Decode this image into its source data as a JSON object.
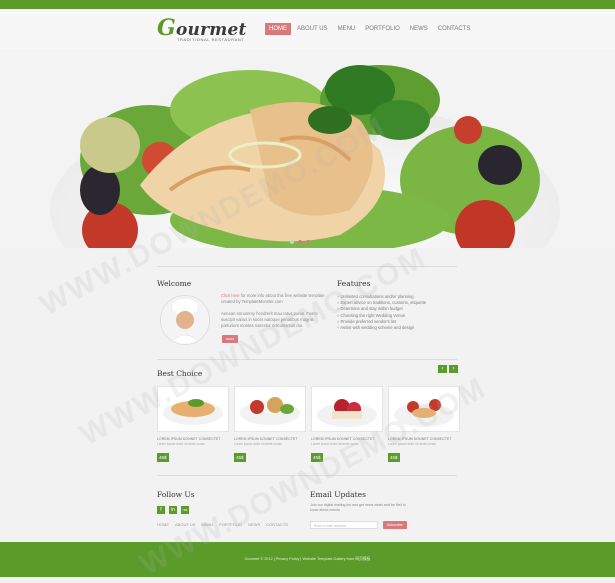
{
  "header": {
    "logo_text": "ourmet",
    "logo_initial": "G",
    "logo_subtitle": "TRADITIONAL RESTAURANT",
    "nav": [
      "HOME",
      "ABOUT US",
      "MENU",
      "PORTFOLIO",
      "NEWS",
      "CONTACTS"
    ],
    "active_nav": "HOME"
  },
  "welcome": {
    "title": "Welcome",
    "text_highlight": "Click here",
    "text_1": " for more info about this free website template created by TemplateMonster.com",
    "text_2": "Aenean nonummy hendrerit mau ratus purus. Fusce suscipit varius in sociis natoque penatibus magnis parturient montes nascetur ridiculusmus dui.",
    "button_label": "more"
  },
  "features": {
    "title": "Features",
    "items": [
      "Unlimited consultations and/or planning",
      "Expert advice on traditions, customs, etiquette",
      "Determine and stay within budget",
      "Choosing the right Wedding Venue",
      "Provide preferred vendor's list",
      "Assist with wedding scheme and design"
    ]
  },
  "best_choice": {
    "title": "Best Choice",
    "prev_label": "‹",
    "next_label": "›",
    "cards": [
      {
        "title": "LOREM IPSUM DONNET CONSECTET",
        "text": "Lorem ipsum dolor sit amet conse",
        "price": "45$"
      },
      {
        "title": "LOREM IPSUM DONNET CONSECTET",
        "text": "Lorem ipsum dolor sit amet conse",
        "price": "45$"
      },
      {
        "title": "LOREM IPSUM DONNET CONSECTET",
        "text": "Lorem ipsum dolor sit amet conse",
        "price": "45$"
      },
      {
        "title": "LOREM IPSUM DONNET CONSECTET",
        "text": "Lorem ipsum dolor sit amet conse",
        "price": "45$"
      }
    ]
  },
  "follow": {
    "title": "Follow Us",
    "icons": [
      "f",
      "in",
      "rss"
    ],
    "footer_nav": [
      "HOME",
      "ABOUT US",
      "MENU",
      "PORTFOLIO",
      "NEWS",
      "CONTACTS"
    ]
  },
  "email_updates": {
    "title": "Email Updates",
    "text": "Join our digital mailing list and get news deals and be first to know about events",
    "placeholder": "Enter e-mail address",
    "button_label": "Subscribe"
  },
  "footer": {
    "copyright": "Gourmet © 2012  |  Privacy Policy  |  Website Template Gallery from 网页模板"
  },
  "watermark_text": "WWW.DOWNDEMO.COM",
  "colors": {
    "accent_green": "#5a9b2a",
    "accent_pink": "#d8797c"
  }
}
